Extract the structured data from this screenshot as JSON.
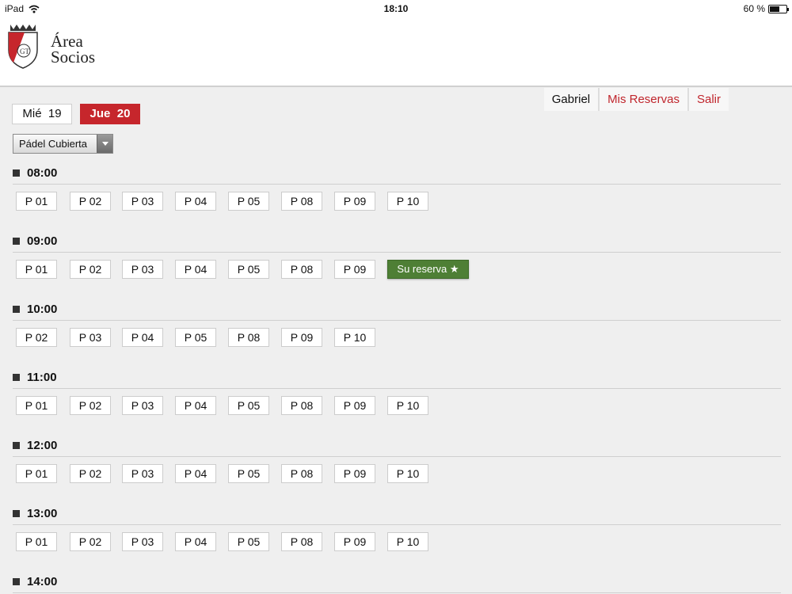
{
  "statusbar": {
    "device": "iPad",
    "time": "18:10",
    "battery": "60 %",
    "battery_level": 0.6
  },
  "brand": {
    "line1": "Área",
    "line2": "Socios",
    "logo_letters": "GT",
    "logo_color": "#c6262c"
  },
  "nav": {
    "user": "Gabriel",
    "reservations": "Mis Reservas",
    "logout": "Salir"
  },
  "days": {
    "prev_name": "Mié",
    "prev_num": "19",
    "current_name": "Jue",
    "current_num": "20"
  },
  "facility_select": {
    "value": "Pádel Cubierta"
  },
  "colors": {
    "accent": "#c6262c",
    "reserved": "#4e7f35"
  },
  "slots": [
    {
      "time": "08:00",
      "courts": [
        "P 01",
        "P 02",
        "P 03",
        "P 04",
        "P 05",
        "P 08",
        "P 09",
        "P 10"
      ]
    },
    {
      "time": "09:00",
      "courts": [
        "P 01",
        "P 02",
        "P 03",
        "P 04",
        "P 05",
        "P 08",
        "P 09"
      ],
      "reservation": "Su reserva ★"
    },
    {
      "time": "10:00",
      "courts": [
        "P 02",
        "P 03",
        "P 04",
        "P 05",
        "P 08",
        "P 09",
        "P 10"
      ]
    },
    {
      "time": "11:00",
      "courts": [
        "P 01",
        "P 02",
        "P 03",
        "P 04",
        "P 05",
        "P 08",
        "P 09",
        "P 10"
      ]
    },
    {
      "time": "12:00",
      "courts": [
        "P 01",
        "P 02",
        "P 03",
        "P 04",
        "P 05",
        "P 08",
        "P 09",
        "P 10"
      ]
    },
    {
      "time": "13:00",
      "courts": [
        "P 01",
        "P 02",
        "P 03",
        "P 04",
        "P 05",
        "P 08",
        "P 09",
        "P 10"
      ]
    },
    {
      "time": "14:00",
      "courts": []
    }
  ]
}
